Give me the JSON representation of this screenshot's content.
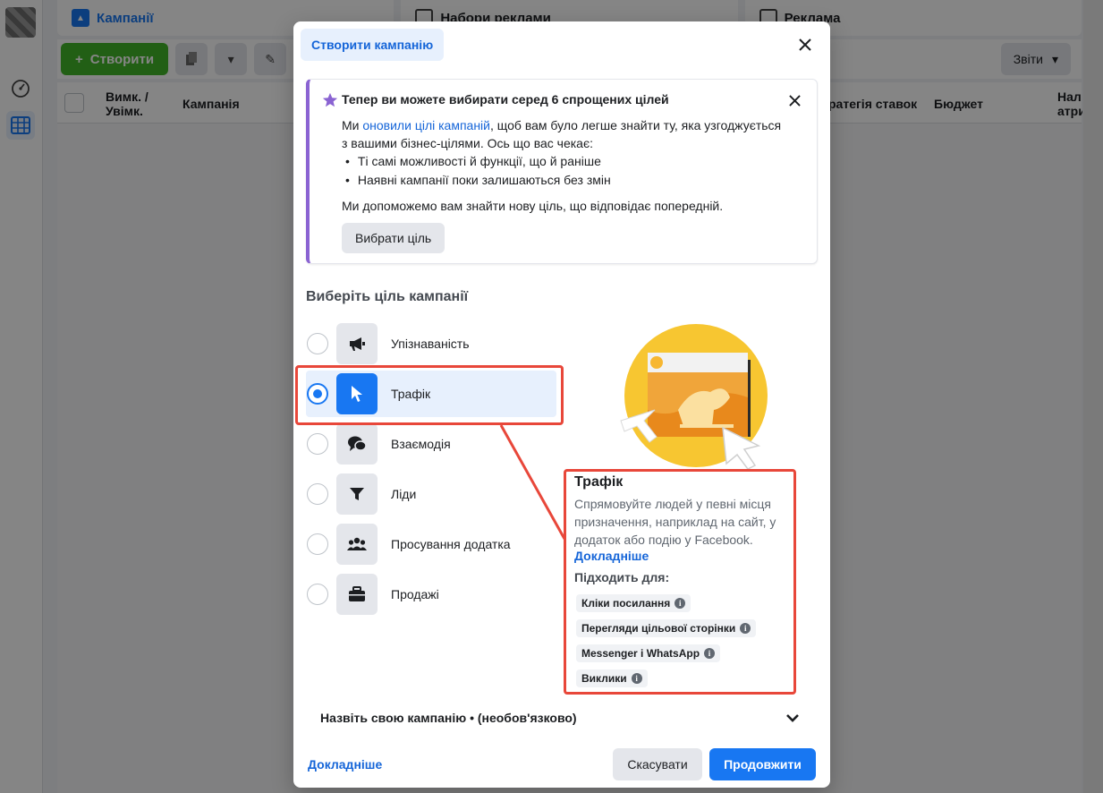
{
  "background": {
    "tabs": [
      {
        "label": "Кампанії",
        "icon": "campaign-folder-icon"
      },
      {
        "label": "Набори реклами",
        "icon": "grid-icon"
      },
      {
        "label": "Реклама",
        "icon": "ad-icon"
      }
    ],
    "toolbar": {
      "create_label": "Створити",
      "reports_label": "Звіти"
    },
    "table_headers": {
      "toggle": "Вимк. / Увімк.",
      "campaign": "Кампанія",
      "bid_strategy": "ратегія ставок",
      "budget": "Бюджет",
      "attribution": "Нал атри"
    }
  },
  "modal": {
    "title": "Створити кампанію",
    "notice": {
      "title": "Тепер ви можете вибирати серед 6 спрощених цілей",
      "text_before_link": "Ми ",
      "link": "оновили цілі кампаній",
      "text_after_link": ", щоб вам було легше знайти ту, яка узгоджується з вашими бізнес-цілями. Ось що вас чекає:",
      "bullets": [
        "Ті самі можливості й функції, що й раніше",
        "Наявні кампанії поки залишаються без змін"
      ],
      "help": "Ми допоможемо вам знайти нову ціль, що відповідає попередній.",
      "button": "Вибрати ціль"
    },
    "section_title": "Виберіть ціль кампанії",
    "objectives": [
      {
        "label": "Упізнаваність",
        "icon": "megaphone-icon",
        "selected": false
      },
      {
        "label": "Трафік",
        "icon": "cursor-icon",
        "selected": true
      },
      {
        "label": "Взаємодія",
        "icon": "chat-bubbles-icon",
        "selected": false
      },
      {
        "label": "Ліди",
        "icon": "funnel-icon",
        "selected": false
      },
      {
        "label": "Просування додатка",
        "icon": "people-icon",
        "selected": false
      },
      {
        "label": "Продажі",
        "icon": "briefcase-icon",
        "selected": false
      }
    ],
    "description": {
      "title": "Трафік",
      "text": "Спрямовуйте людей у певні місця призначення, наприклад на сайт, у додаток або подію у Facebook.",
      "learn_more": "Докладніше",
      "fit_for": "Підходить для:",
      "chips": [
        "Кліки посилання",
        "Перегляди цільової сторінки",
        "Messenger і WhatsApp",
        "Виклики"
      ]
    },
    "name_campaign": "Назвіть свою кампанію • (необов'язково)",
    "footer": {
      "learn_more": "Докладніше",
      "cancel": "Скасувати",
      "continue": "Продовжити"
    },
    "colors": {
      "primary": "#1877f2",
      "highlight": "#e8473a",
      "notice_accent": "#8a63d2",
      "illustration_yellow": "#f7c631",
      "illustration_orange": "#e8891c"
    }
  }
}
